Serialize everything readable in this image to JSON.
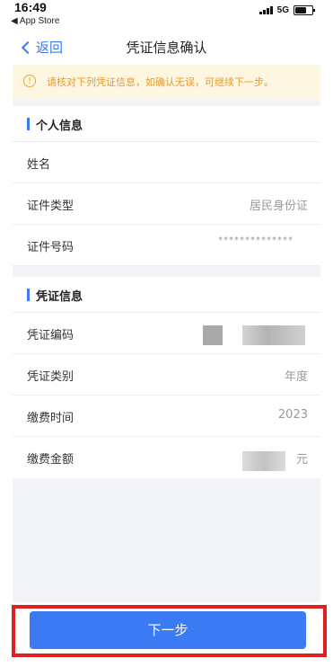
{
  "status_bar": {
    "time": "16:49",
    "back_app": "◀ App Store",
    "network": "5G"
  },
  "nav": {
    "back_label": "返回",
    "title": "凭证信息确认"
  },
  "notice": {
    "icon": "info-icon",
    "text": "请核对下列凭证信息，如确认无误，可继续下一步。"
  },
  "personal": {
    "section_title": "个人信息",
    "name_label": "姓名",
    "id_type_label": "证件类型",
    "id_type_value": "居民身份证",
    "id_number_label": "证件号码",
    "id_number_value": "**************"
  },
  "voucher": {
    "section_title": "凭证信息",
    "code_label": "凭证编码",
    "type_label": "凭证类别",
    "type_value": "年度",
    "time_label": "缴费时间",
    "time_value": "2023",
    "amount_label": "缴费金额",
    "amount_unit": "元"
  },
  "footer": {
    "next_label": "下一步"
  },
  "colors": {
    "accent": "#3a7af2",
    "notice_bg": "#fdf7e1",
    "notice_text": "#e39b30",
    "highlight": "#e02020",
    "page_bg": "#f2f4f7"
  }
}
